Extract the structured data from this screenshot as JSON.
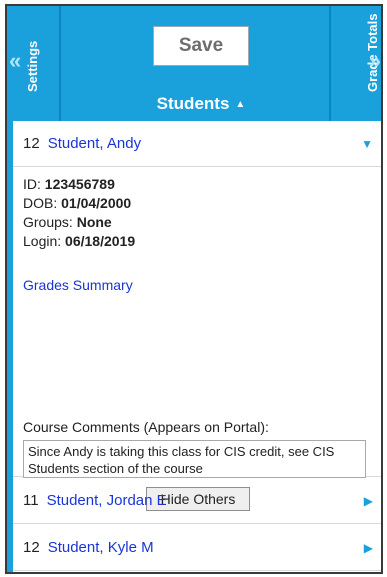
{
  "header": {
    "settings_label": "Settings",
    "grade_totals_label": "Grade Totals",
    "save_label": "Save",
    "students_label": "Students",
    "colors": {
      "accent": "#1aa1dc",
      "link": "#1a35d6"
    }
  },
  "students": [
    {
      "grade": "12",
      "name": "Student, Andy",
      "expanded": true
    },
    {
      "grade": "11",
      "name": "Student, Jordan E",
      "expanded": false
    },
    {
      "grade": "12",
      "name": "Student, Kyle M",
      "expanded": false
    }
  ],
  "details": {
    "id_label": "ID:",
    "id_value": "123456789",
    "dob_label": "DOB:",
    "dob_value": "01/04/2000",
    "groups_label": "Groups:",
    "groups_value": "None",
    "login_label": "Login:",
    "login_value": "06/18/2019",
    "grades_summary_link": "Grades Summary",
    "comments_label": "Course Comments (Appears on Portal):",
    "comments_value": "Since Andy is taking this class for CIS credit, see CIS Students section of the course",
    "hide_others_label": "Hide Others"
  }
}
